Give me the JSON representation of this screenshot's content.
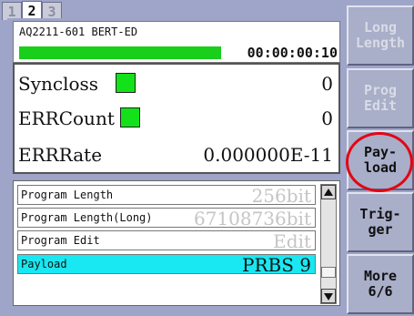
{
  "tabs": [
    {
      "label": "1",
      "active": false
    },
    {
      "label": "2",
      "active": true
    },
    {
      "label": "3",
      "active": false
    }
  ],
  "header": {
    "device_id": "AQ2211-601 BERT-ED",
    "timer": "00:00:00:10",
    "progress_fraction": 0.65,
    "progress_color": "#19cf1c"
  },
  "status": {
    "syncloss_label": "Syncloss",
    "syncloss_value": "0",
    "errcount_label": "ERRCount",
    "errcount_value": "0",
    "errrate_label": "ERRRate",
    "errrate_value": "0.000000E-11",
    "indicator_color": "#13e21a"
  },
  "list": {
    "items": [
      {
        "label": "Program Length",
        "value": "256bit",
        "selected": false
      },
      {
        "label": "Program Length(Long)",
        "value": "67108736bit",
        "selected": false
      },
      {
        "label": "Program Edit",
        "value": "Edit",
        "selected": false
      },
      {
        "label": "Payload",
        "value": "PRBS 9",
        "selected": true
      }
    ],
    "selected_color": "#19e8f2"
  },
  "sidebar": {
    "buttons": [
      {
        "label": "Long\nLength",
        "enabled": false
      },
      {
        "label": "Prog\nEdit",
        "enabled": false
      },
      {
        "label": "Pay-\nload",
        "enabled": true,
        "highlighted": true
      },
      {
        "label": "Trig-\nger",
        "enabled": true
      },
      {
        "label": "More\n6/6",
        "enabled": true
      }
    ],
    "highlight_color": "#e30613"
  }
}
